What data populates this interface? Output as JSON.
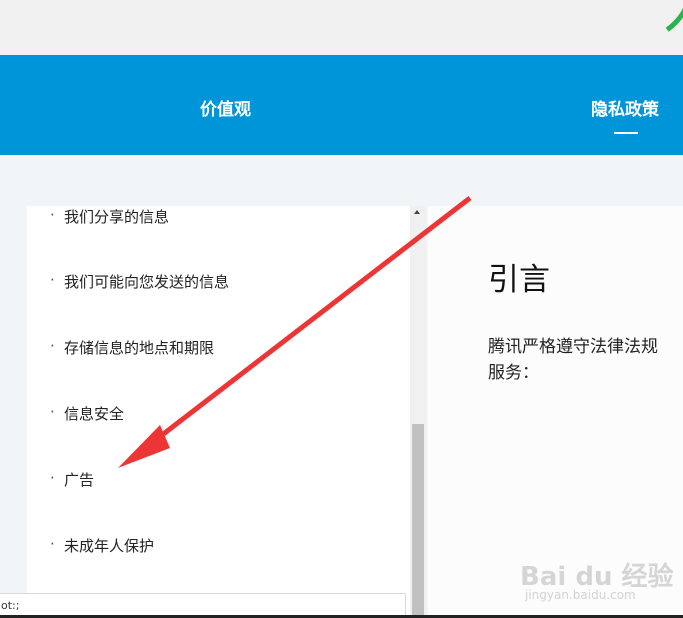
{
  "nav": {
    "values_label": "价值观",
    "privacy_label": "隐私政策"
  },
  "toc": {
    "items": [
      "我们分享的信息",
      "我们可能向您发送的信息",
      "存储信息的地点和期限",
      "信息安全",
      "广告",
      "未成年人保护"
    ],
    "bullet": "·"
  },
  "status_bar_text": "ot:;",
  "content": {
    "heading": "引言",
    "paragraph_line1": "腾讯严格遵守法律法规",
    "paragraph_line2": "服务："
  },
  "watermark": {
    "brand": "Bai du 经验",
    "url": "jingyan.baidu.com"
  },
  "colors": {
    "nav_bg": "#0094d8",
    "arrow": "#ee3535",
    "accent_green": "#2bb34d"
  }
}
